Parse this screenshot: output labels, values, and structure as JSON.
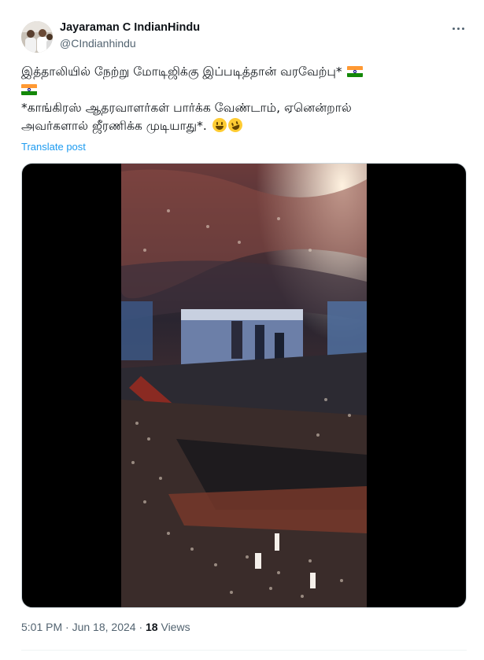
{
  "author": {
    "name": "Jayaraman C IndianHindu",
    "handle": "@CIndianhindu",
    "avatar_icon": "profile-photo-avatar"
  },
  "post": {
    "line1": "இத்தாலியில் நேற்று மோடிஜிக்கு இப்படித்தான் வரவேற்பு*",
    "line3": "*காங்கிரஸ் ஆதரவாளர்கள்  பார்க்க வேண்டாம், ஏனென்றால்",
    "line4": "அவர்களால்  ஜீரணிக்க முடியாது*.",
    "flag_icon": "india-flag-icon",
    "emojis": [
      "grinning-face-emoji",
      "rolling-on-floor-laughing-emoji"
    ]
  },
  "translate_label": "Translate post",
  "media": {
    "type": "video",
    "description_icon": "video-thumbnail"
  },
  "meta": {
    "time": "5:01 PM",
    "separator": " · ",
    "date": "Jun 18, 2024",
    "views_count": "18",
    "views_label": "Views"
  },
  "more_icon": "more-options-icon",
  "colors": {
    "text_primary": "#0f1419",
    "text_secondary": "#536471",
    "link": "#1d9bf0",
    "border": "#cfd9de"
  }
}
